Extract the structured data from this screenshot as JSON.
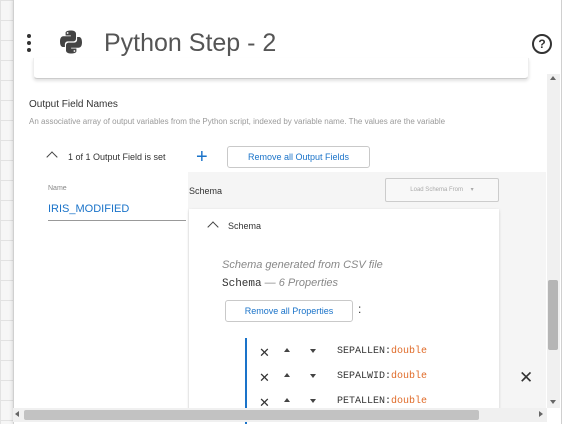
{
  "header": {
    "title": "Python Step - 2",
    "help_icon": "question-circle-icon",
    "menu_icon": "kebab-menu-icon",
    "logo_icon": "python-logo-icon"
  },
  "section": {
    "title": "Output Field Names",
    "description": "An associative array of output variables from the Python script, indexed by variable name. The values are the variable"
  },
  "output_fields": {
    "count_label": "1 of 1 Output Field is set",
    "add_icon": "+",
    "remove_all_label": "Remove all Output Fields",
    "name_label": "Name",
    "name_value": "IRIS_MODIFIED",
    "schema_label": "Schema",
    "load_schema_label": "Load Schema From",
    "load_schema_caret": "▾"
  },
  "schema": {
    "title": "Schema",
    "csv_note": "Schema generated from CSV file",
    "name": "Schema",
    "properties_note": "— 6 Properties",
    "remove_all_label": "Remove all Properties",
    "colon": ":",
    "properties": [
      {
        "name": "SEPALLEN:",
        "type": "double"
      },
      {
        "name": "SEPALWID:",
        "type": "double"
      },
      {
        "name": "PETALLEN:",
        "type": "double"
      }
    ]
  },
  "glyphs": {
    "close": "✕",
    "help": "?"
  },
  "colors": {
    "accent": "#1a73c9",
    "type": "#e06c2a"
  }
}
